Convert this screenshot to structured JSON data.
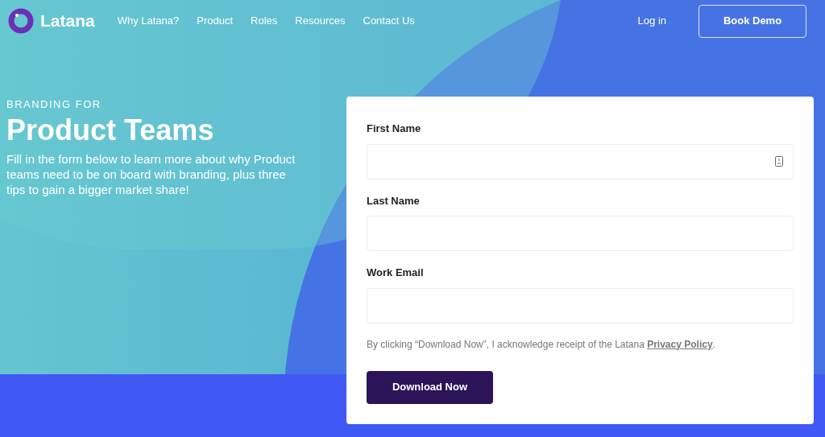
{
  "nav": {
    "logo": "Latana",
    "links": [
      "Why Latana?",
      "Product",
      "Roles",
      "Resources",
      "Contact Us"
    ],
    "login": "Log in",
    "cta": "Book Demo"
  },
  "hero": {
    "eyebrow": "BRANDING FOR",
    "title": "Product Teams",
    "text": "Fill in the form below to learn more about why Product teams need to be on board with branding, plus three tips to gain a bigger market share!"
  },
  "form": {
    "fields": [
      {
        "label": "First Name",
        "kind": "autofill"
      },
      {
        "label": "Last Name",
        "kind": "plain"
      },
      {
        "label": "Work Email",
        "kind": "plain"
      }
    ],
    "consent": {
      "before": "By clicking “Download Now”, I acknowledge receipt of the Latana ",
      "link": "Privacy Policy",
      "after": "."
    },
    "submit": "Download Now"
  }
}
